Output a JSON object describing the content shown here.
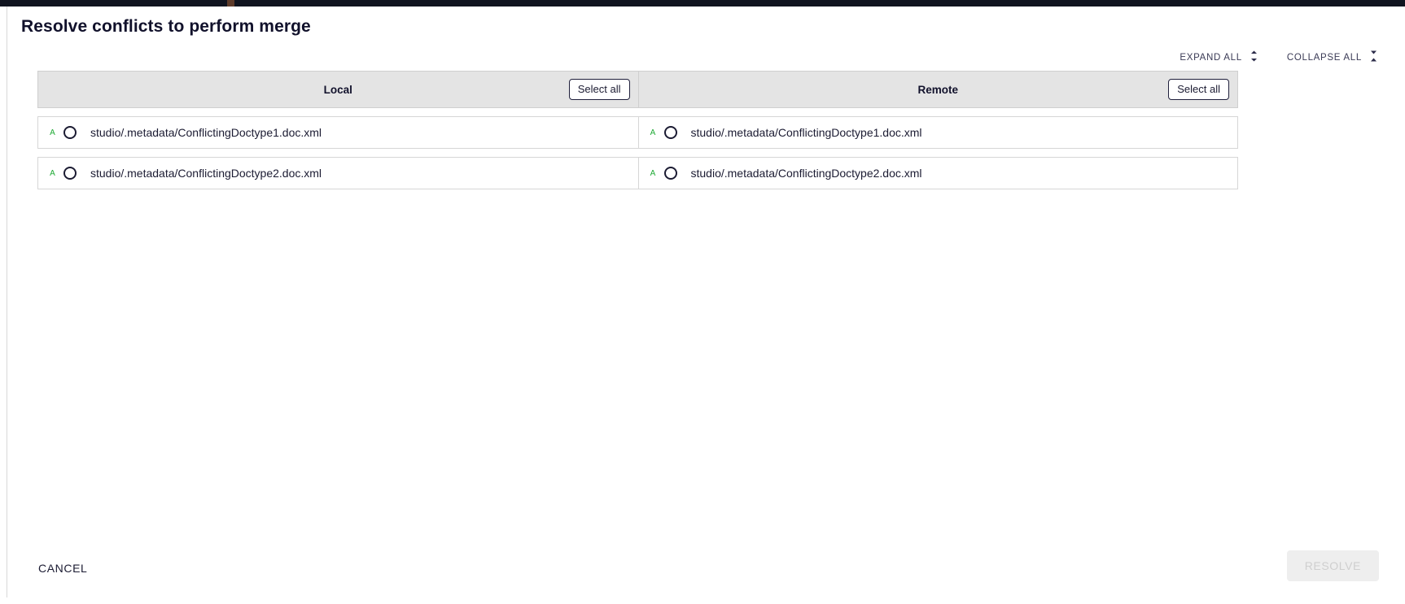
{
  "window": {
    "title": "Resolve conflicts to perform merge"
  },
  "toolbar": {
    "expand_all_label": "EXPAND ALL",
    "expand_all_icon": "expand-vertical-icon",
    "collapse_all_label": "COLLAPSE ALL",
    "collapse_all_icon": "collapse-vertical-icon"
  },
  "table": {
    "columns": [
      {
        "label": "Local",
        "select_all_label": "Select all"
      },
      {
        "label": "Remote",
        "select_all_label": "Select all"
      }
    ],
    "rows": [
      {
        "local": {
          "status": "A",
          "path": "studio/.metadata/ConflictingDoctype1.doc.xml",
          "selected": false
        },
        "remote": {
          "status": "A",
          "path": "studio/.metadata/ConflictingDoctype1.doc.xml",
          "selected": false
        }
      },
      {
        "local": {
          "status": "A",
          "path": "studio/.metadata/ConflictingDoctype2.doc.xml",
          "selected": false
        },
        "remote": {
          "status": "A",
          "path": "studio/.metadata/ConflictingDoctype2.doc.xml",
          "selected": false
        }
      }
    ]
  },
  "footer": {
    "cancel_label": "CANCEL",
    "resolve_label": "RESOLVE",
    "resolve_disabled": true
  },
  "colors": {
    "status_added": "#1faa35",
    "header_bg": "#e4e4e4",
    "title_text": "#11112b",
    "disabled_button_bg": "#eeeeee",
    "disabled_button_text": "#cfcfcf",
    "topbar": "#10141f"
  }
}
